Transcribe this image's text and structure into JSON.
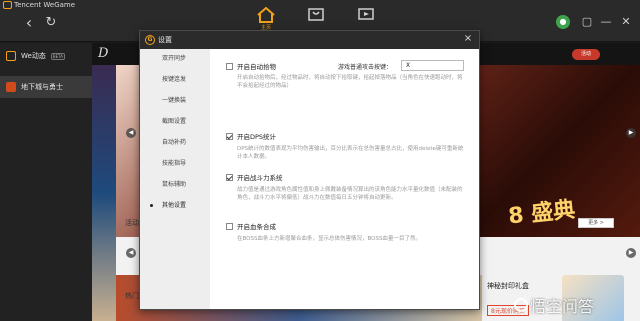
{
  "app": {
    "brand": "Tencent WeGame",
    "top_tab_active_label": "主页",
    "colors": {
      "accent": "#f0a21a",
      "titlebar": "#2a2a2a",
      "dialog_header": "#2b2b2b"
    }
  },
  "sidebar": {
    "items": [
      {
        "label": "We动态",
        "badge": "BETA"
      },
      {
        "label": "地下城与勇士"
      }
    ]
  },
  "background": {
    "logo": "D",
    "activity_button": "活动",
    "activity_heading": "活动",
    "hot_heading": "热门",
    "gift": {
      "title": "神秘封印礼盒",
      "price": "8元现价购买",
      "more": "更多 >"
    }
  },
  "dialog": {
    "title": "设置",
    "close": "×",
    "nav": [
      {
        "label": "双开同步"
      },
      {
        "label": "按键连发"
      },
      {
        "label": "一键换装"
      },
      {
        "label": "截图设置"
      },
      {
        "label": "自动补药"
      },
      {
        "label": "技能指导"
      },
      {
        "label": "鼠标辅助"
      },
      {
        "label": "其他设置",
        "active": true
      }
    ],
    "options": [
      {
        "label": "开启自动拾物",
        "checked": false,
        "desc": "开启自动拾物后，经过物品时，将自动按下拾取键，拾起掉落物品（当角色在快速跑动时，将不会拾起经过的物品）"
      },
      {
        "label": "开启DPS统计",
        "checked": true,
        "desc": "DPS统计的数值表现为平均伤害输出，百分比表示在总伤害量总占比，使用delete键可重新统计本人数据。"
      },
      {
        "label": "开启战斗力系统",
        "checked": true,
        "desc": "战力值是通过游戏角色属性值和身上佩戴装备情况算出的该角色能力水平量化数值（未配装的角色，战斗力水平将偏低）战斗力在数值每日五分钟将自动更新。"
      },
      {
        "label": "开启血条合成",
        "checked": false,
        "desc": "在BOSS血条上方新增聚合血条，显示总体伤害情况，BOSS血量一目了然。"
      }
    ],
    "hotkey": {
      "label": "游戏普通攻击按键：",
      "value": "X"
    }
  },
  "watermark": "悟空问答"
}
